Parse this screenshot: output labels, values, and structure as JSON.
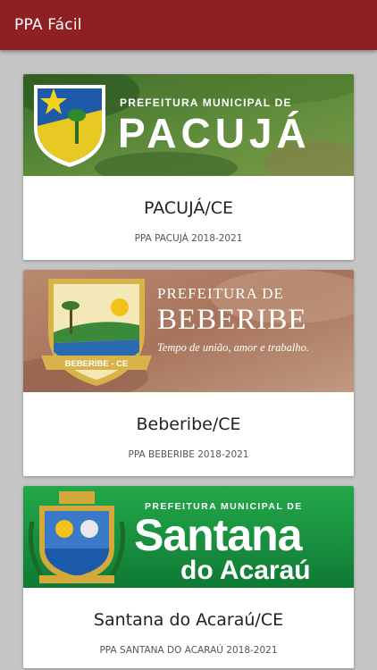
{
  "app": {
    "title": "PPA Fácil"
  },
  "cards": [
    {
      "banner": {
        "line1": "PREFEITURA MUNICIPAL DE",
        "line2": "PACUJÁ"
      },
      "title": "PACUJÁ/CE",
      "subtitle": "PPA PACUJÁ 2018-2021"
    },
    {
      "banner": {
        "line1": "PREFEITURA DE",
        "line2": "BEBERIBE",
        "slogan": "Tempo de união, amor e trabalho.",
        "badge": "BEBERIBE - CE"
      },
      "title": "Beberibe/CE",
      "subtitle": "PPA BEBERIBE 2018-2021"
    },
    {
      "banner": {
        "line1": "PREFEITURA MUNICIPAL DE",
        "line2": "Santana",
        "line3": "do Acaraú"
      },
      "title": "Santana do Acaraú/CE",
      "subtitle": "PPA SANTANA DO ACARAÚ 2018-2021"
    }
  ],
  "colors": {
    "appbar": "#8e1f22",
    "background": "#c5c5c5"
  }
}
